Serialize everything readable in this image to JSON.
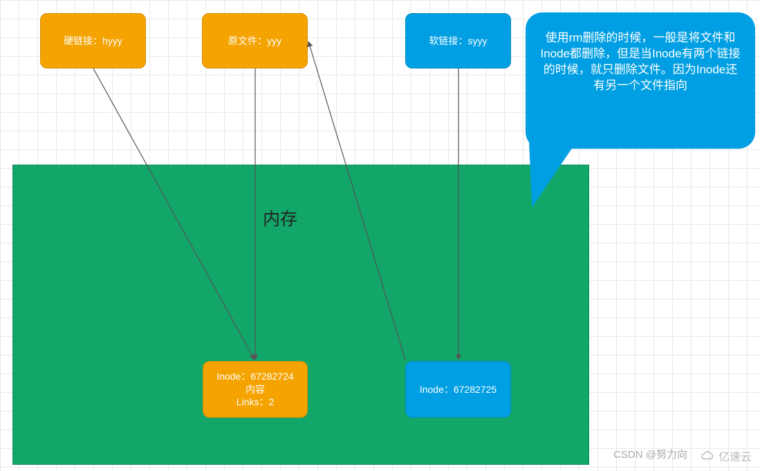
{
  "files": {
    "hardlink": {
      "label": "硬链接：hyyy"
    },
    "original": {
      "label": "原文件：yyy"
    },
    "softlink": {
      "label": "软链接：syyy"
    }
  },
  "memory": {
    "title": "内存"
  },
  "inodes": {
    "main": {
      "line1": "Inode：67282724",
      "line2": "内容",
      "line3": "Links：2"
    },
    "soft": {
      "line1": "Inode：67282725"
    }
  },
  "callout": {
    "text": "使用rm删除的时候，一般是将文件和Inode都删除，但是当Inode有两个链接的时候，就只删除文件。因为Inode还有另一个文件指向"
  },
  "watermarks": {
    "csdn": "CSDN @努力向",
    "yisu": "亿速云"
  },
  "colors": {
    "orange": "#f4a300",
    "blue": "#009fe3",
    "green": "#12a669"
  }
}
